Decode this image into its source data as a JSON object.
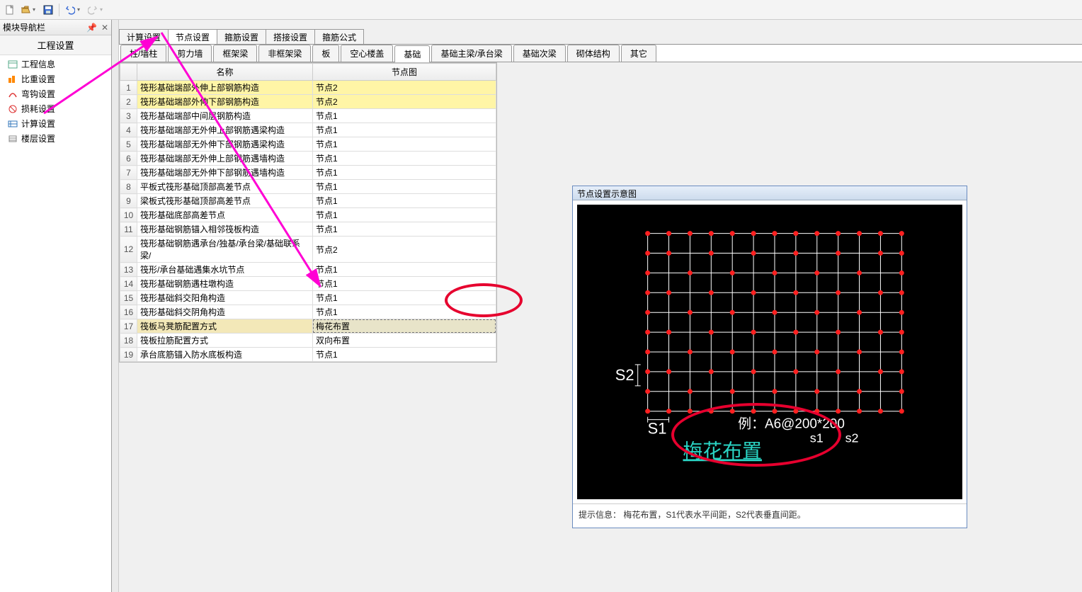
{
  "sidebar": {
    "header": "模块导航栏",
    "section_title": "工程设置",
    "items": [
      {
        "label": "工程信息"
      },
      {
        "label": "比重设置"
      },
      {
        "label": "弯钩设置"
      },
      {
        "label": "损耗设置"
      },
      {
        "label": "计算设置"
      },
      {
        "label": "楼层设置"
      }
    ]
  },
  "upper_tabs": [
    "计算设置",
    "节点设置",
    "箍筋设置",
    "搭接设置",
    "箍筋公式"
  ],
  "active_upper_tab": 1,
  "sub_tabs": [
    "柱/墙柱",
    "剪力墙",
    "框架梁",
    "非框架梁",
    "板",
    "空心楼盖",
    "基础",
    "基础主梁/承台梁",
    "基础次梁",
    "砌体结构",
    "其它"
  ],
  "active_sub_tab": 6,
  "table": {
    "columns": [
      "名称",
      "节点图"
    ],
    "rows": [
      {
        "n": 1,
        "name": "筏形基础端部外伸上部钢筋构造",
        "val": "节点2",
        "hl": true
      },
      {
        "n": 2,
        "name": "筏形基础端部外伸下部钢筋构造",
        "val": "节点2",
        "hl": true
      },
      {
        "n": 3,
        "name": "筏形基础端部中间层钢筋构造",
        "val": "节点1"
      },
      {
        "n": 4,
        "name": "筏形基础端部无外伸上部钢筋遇梁构造",
        "val": "节点1"
      },
      {
        "n": 5,
        "name": "筏形基础端部无外伸下部钢筋遇梁构造",
        "val": "节点1"
      },
      {
        "n": 6,
        "name": "筏形基础端部无外伸上部钢筋遇墙构造",
        "val": "节点1"
      },
      {
        "n": 7,
        "name": "筏形基础端部无外伸下部钢筋遇墙构造",
        "val": "节点1"
      },
      {
        "n": 8,
        "name": "平板式筏形基础顶部高差节点",
        "val": "节点1"
      },
      {
        "n": 9,
        "name": "梁板式筏形基础顶部高差节点",
        "val": "节点1"
      },
      {
        "n": 10,
        "name": "筏形基础底部高差节点",
        "val": "节点1"
      },
      {
        "n": 11,
        "name": "筏形基础钢筋锚入相邻筏板构造",
        "val": "节点1"
      },
      {
        "n": 12,
        "name": "筏形基础钢筋遇承台/独基/承台梁/基础联系梁/",
        "val": "节点2"
      },
      {
        "n": 13,
        "name": "筏形/承台基础遇集水坑节点",
        "val": "节点1"
      },
      {
        "n": 14,
        "name": "筏形基础钢筋遇柱墩构造",
        "val": "节点1"
      },
      {
        "n": 15,
        "name": "筏形基础斜交阳角构造",
        "val": "节点1"
      },
      {
        "n": 16,
        "name": "筏形基础斜交阴角构造",
        "val": "节点1"
      },
      {
        "n": 17,
        "name": "筏板马凳筋配置方式",
        "val": "梅花布置",
        "sel": true
      },
      {
        "n": 18,
        "name": "筏板拉筋配置方式",
        "val": "双向布置"
      },
      {
        "n": 19,
        "name": "承台底筋锚入防水底板构造",
        "val": "节点1"
      }
    ]
  },
  "preview": {
    "title": "节点设置示意图",
    "label_s1": "S1",
    "label_s2": "S2",
    "example": "例：A6@200*200",
    "sub_s1": "s1",
    "sub_s2": "s2",
    "pattern_label": "梅花布置",
    "hint": "提示信息： 梅花布置，S1代表水平间距，S2代表垂直间距。"
  }
}
